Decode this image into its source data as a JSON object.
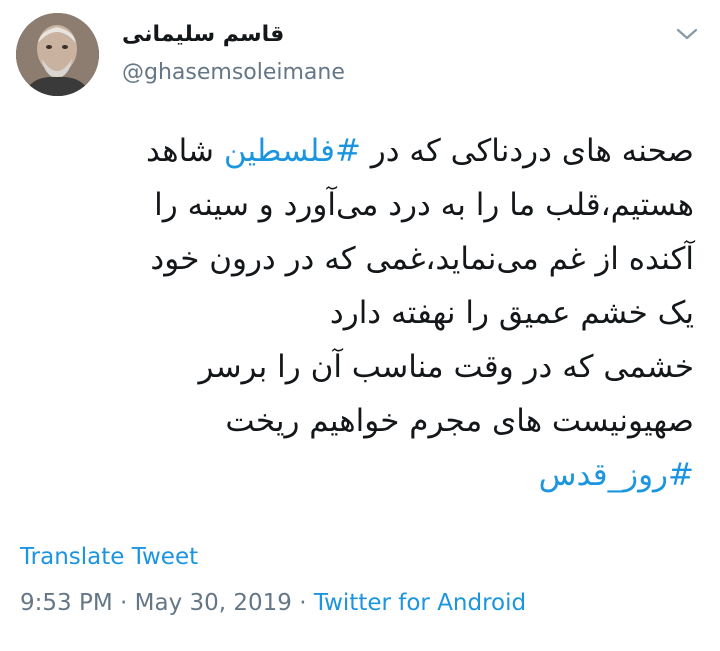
{
  "author": {
    "display_name": "قاسم سلیمانی",
    "handle": "@ghasemsoleimane"
  },
  "tweet": {
    "lines": [
      [
        {
          "text": "صحنه های دردناکی که در "
        },
        {
          "text": "#فلسطین",
          "hashtag": true
        },
        {
          "text": " شاهد"
        }
      ],
      [
        {
          "text": "هستیم،قلب ما را به درد می‌آورد و سینه را"
        }
      ],
      [
        {
          "text": "آکنده از غم می‌نماید،غمی که در درون خود"
        }
      ],
      [
        {
          "text": "یک خشم عمیق را نهفته دارد"
        }
      ],
      [
        {
          "text": "خشمی که در وقت مناسب آن را برسر"
        }
      ],
      [
        {
          "text": "صهیونیست های مجرم خواهیم ریخت"
        }
      ],
      [
        {
          "text": "#روز_قدس",
          "hashtag": true
        }
      ]
    ]
  },
  "translate_label": "Translate Tweet",
  "meta": {
    "time": "9:53 PM",
    "separator": " · ",
    "date": "May 30, 2019",
    "source": "Twitter for Android"
  },
  "colors": {
    "link": "#1b95e0",
    "secondary_text": "#657786",
    "primary_text": "#14171a"
  },
  "icons": {
    "caret": "chevron-down-icon",
    "avatar": "profile-photo"
  }
}
